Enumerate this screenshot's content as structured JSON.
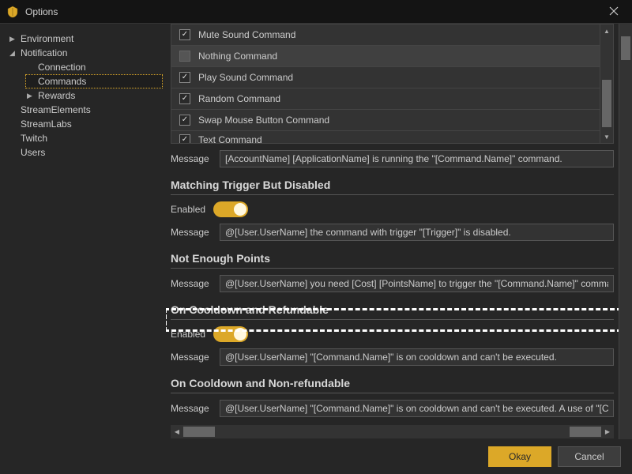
{
  "window": {
    "title": "Options"
  },
  "sidebar": {
    "items": [
      {
        "label": "Environment",
        "expandable": true
      },
      {
        "label": "Notification",
        "expandable": true,
        "expanded": true,
        "children": [
          {
            "label": "Connection"
          },
          {
            "label": "Commands",
            "selected": true
          },
          {
            "label": "Rewards",
            "expandable": true
          }
        ]
      },
      {
        "label": "StreamElements"
      },
      {
        "label": "StreamLabs"
      },
      {
        "label": "Twitch"
      },
      {
        "label": "Users"
      }
    ]
  },
  "commands_list": [
    {
      "label": "Mute Sound Command",
      "checked": true
    },
    {
      "label": "Nothing Command",
      "checked": false,
      "selected": true
    },
    {
      "label": "Play Sound Command",
      "checked": true
    },
    {
      "label": "Random Command",
      "checked": true
    },
    {
      "label": "Swap Mouse Button Command",
      "checked": true
    },
    {
      "label": "Text Command",
      "checked": true,
      "partial": true
    }
  ],
  "top_message": {
    "label": "Message",
    "value": "[AccountName] [ApplicationName] is running the \"[Command.Name]\" command."
  },
  "sections": {
    "disabled": {
      "title": "Matching Trigger But Disabled",
      "enabled_label": "Enabled",
      "message_label": "Message",
      "message_value": "@[User.UserName] the command with trigger \"[Trigger]\" is disabled."
    },
    "points": {
      "title": "Not Enough Points",
      "message_label": "Message",
      "message_value": "@[User.UserName] you need [Cost] [PointsName] to trigger the \"[Command.Name]\" command."
    },
    "cooldown_refund": {
      "title": "On Cooldown and Refundable",
      "enabled_label": "Enabled",
      "message_label": "Message",
      "message_value": "@[User.UserName] \"[Command.Name]\" is on cooldown and can't be executed."
    },
    "cooldown_norefund": {
      "title": "On Cooldown and Non-refundable",
      "message_label": "Message",
      "message_value": "@[User.UserName] \"[Command.Name]\" is on cooldown and can't be executed. A use of \"[Command.N"
    }
  },
  "footer": {
    "okay": "Okay",
    "cancel": "Cancel"
  }
}
